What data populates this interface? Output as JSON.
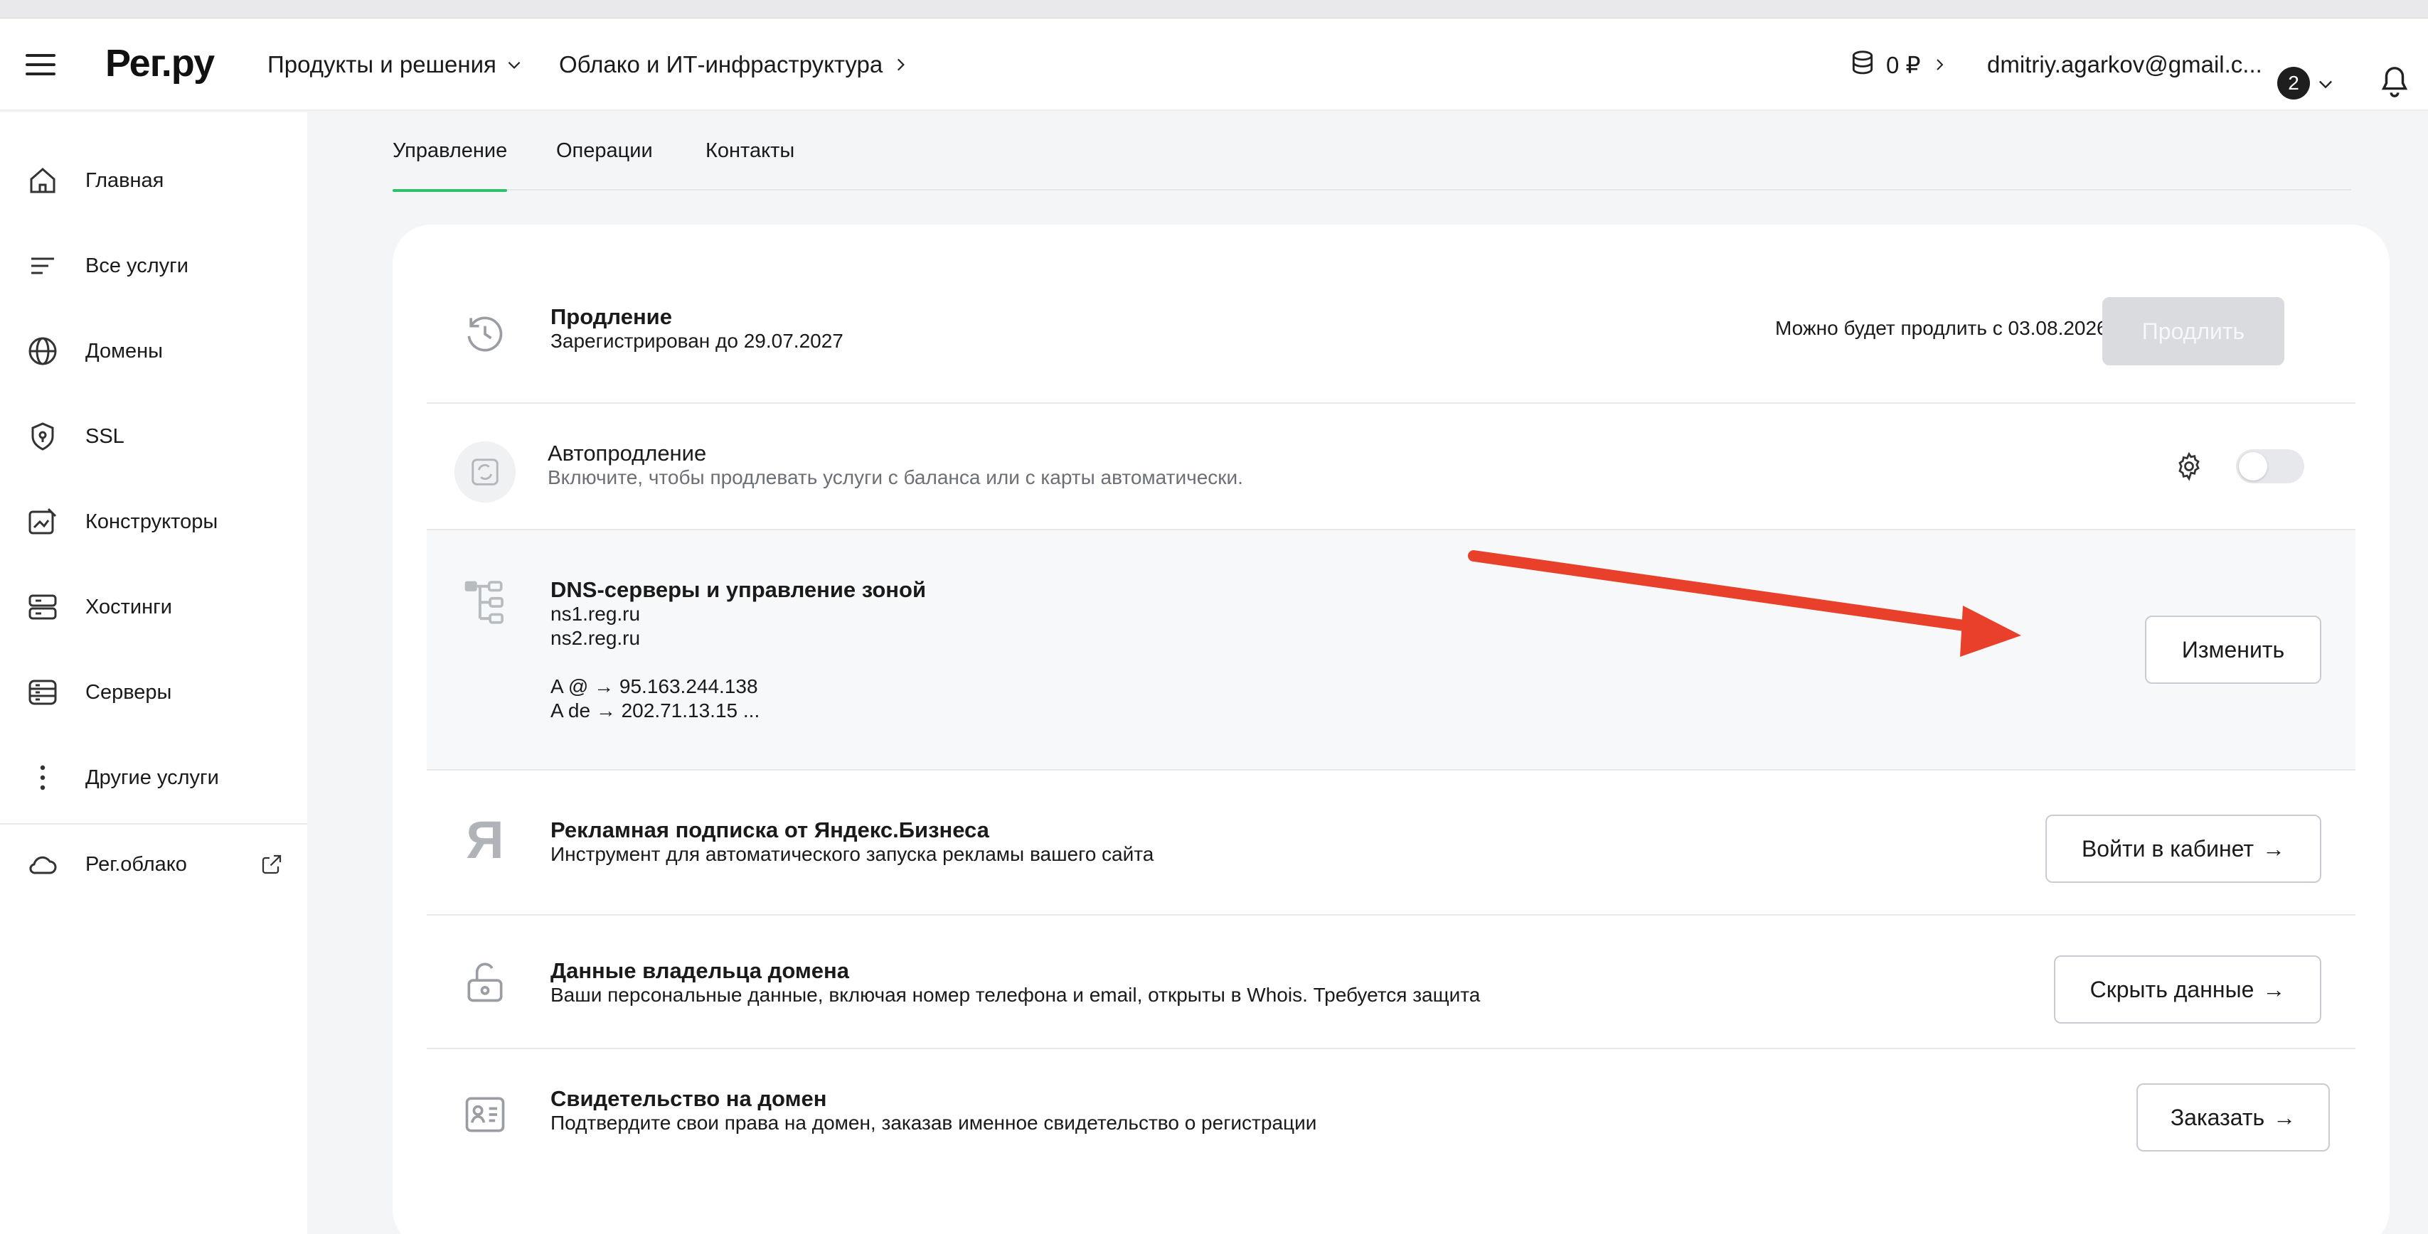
{
  "header": {
    "logo": "Рег.ру",
    "nav": [
      {
        "label": "Продукты и решения"
      },
      {
        "label": "Облако и ИТ-инфраструктура"
      }
    ],
    "balance": "0 ₽",
    "email": "dmitriy.agarkov@gmail.c...",
    "notifications_count": "2"
  },
  "sidebar": {
    "items": [
      {
        "label": "Главная",
        "icon": "home-icon"
      },
      {
        "label": "Все услуги",
        "icon": "list-icon"
      },
      {
        "label": "Домены",
        "icon": "globe-icon"
      },
      {
        "label": "SSL",
        "icon": "shield-icon"
      },
      {
        "label": "Конструкторы",
        "icon": "constructor-icon"
      },
      {
        "label": "Хостинги",
        "icon": "hosting-icon"
      },
      {
        "label": "Серверы",
        "icon": "server-icon"
      },
      {
        "label": "Другие услуги",
        "icon": "more-vertical-icon"
      }
    ],
    "cloud": {
      "label": "Рег.облако",
      "icon": "cloud-icon"
    }
  },
  "tabs": [
    {
      "label": "Управление",
      "active": true
    },
    {
      "label": "Операции",
      "active": false
    },
    {
      "label": "Контакты",
      "active": false
    }
  ],
  "rows": {
    "renewal": {
      "title": "Продление",
      "subtitle": "Зарегистрирован до 29.07.2027",
      "note": "Можно будет продлить с 03.08.2026",
      "button": "Продлить"
    },
    "autorenew": {
      "title": "Автопродление",
      "subtitle": "Включите, чтобы продлевать услуги с баланса или с карты автоматически.",
      "enabled": false
    },
    "dns": {
      "title": "DNS-серверы и управление зоной",
      "ns1": "ns1.reg.ru",
      "ns2": "ns2.reg.ru",
      "rec1": "A @ → 95.163.244.138",
      "rec2": "A de → 202.71.13.15 ...",
      "button": "Изменить"
    },
    "yandex": {
      "title": "Рекламная подписка от Яндекс.Бизнеса",
      "subtitle": "Инструмент для автоматического запуска рекламы вашего сайта",
      "button": "Войти в кабинет"
    },
    "owner": {
      "title": "Данные владельца домена",
      "subtitle": "Ваши персональные данные, включая номер телефона и email, открыты в Whois. Требуется защита",
      "button": "Скрыть данные"
    },
    "certificate": {
      "title": "Свидетельство на домен",
      "subtitle": "Подтвердите свои права на домен, заказав именное свидетельство о регистрации",
      "button": "Заказать"
    }
  },
  "colors": {
    "accent_green": "#2fc06c",
    "annotation_arrow": "#e8402a"
  }
}
